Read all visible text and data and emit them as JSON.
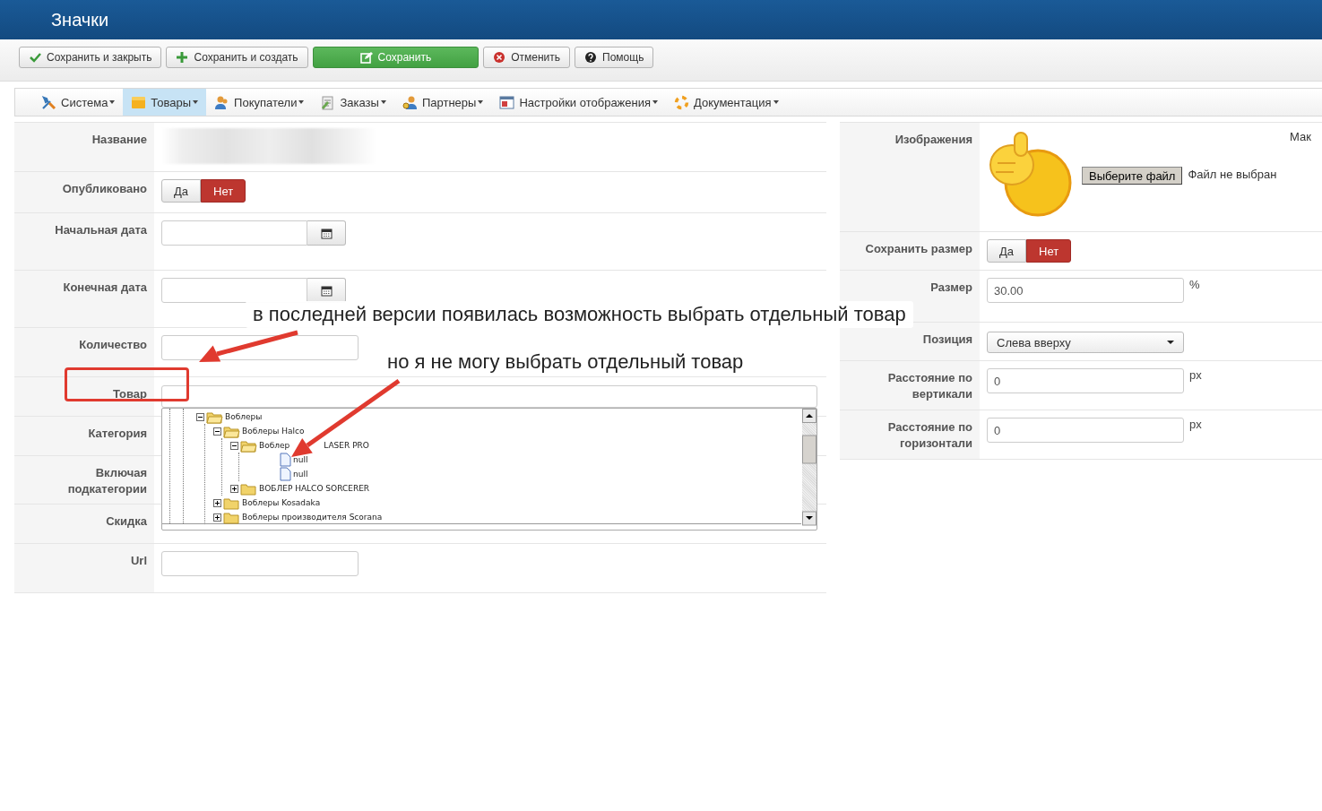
{
  "window": {
    "title": "Значки"
  },
  "toolbar": [
    {
      "label": "Сохранить и закрыть",
      "primary": false
    },
    {
      "label": "Сохранить и создать",
      "primary": false
    },
    {
      "label": "Сохранить",
      "primary": true
    },
    {
      "label": "Отменить",
      "primary": false
    },
    {
      "label": "Помощь",
      "primary": false
    }
  ],
  "menu": [
    {
      "label": "Система",
      "selected": false
    },
    {
      "label": "Товары",
      "selected": true
    },
    {
      "label": "Покупатели",
      "selected": false
    },
    {
      "label": "Заказы",
      "selected": false
    },
    {
      "label": "Партнеры",
      "selected": false
    },
    {
      "label": "Настройки отображения",
      "selected": false
    },
    {
      "label": "Документация",
      "selected": false
    }
  ],
  "left_form": [
    {
      "label": "Название",
      "kind": "redacted"
    },
    {
      "label": "Опубликовано",
      "kind": "toggle",
      "options": [
        {
          "label": "Да",
          "selected": false
        },
        {
          "label": "Нет",
          "selected": true
        }
      ]
    },
    {
      "label": "Начальная дата",
      "kind": "date"
    },
    {
      "label": "Конечная дата",
      "kind": "date"
    },
    {
      "label": "Количество",
      "kind": "input"
    },
    {
      "label": "Товар",
      "kind": "tree_select",
      "tree": [
        {
          "label": "Воблеры",
          "kind": "folder",
          "expanded": true,
          "children": [
            {
              "label": "Воблеры Halco",
              "kind": "folder",
              "expanded": true,
              "children": [
                {
                  "label": "Воблер",
                  "label_end": "LASER PRO",
                  "kind": "folder",
                  "expanded": true,
                  "children": [
                    {
                      "label": "null",
                      "kind": "file"
                    },
                    {
                      "label": "null",
                      "kind": "file"
                    }
                  ]
                },
                {
                  "label": "ВОБЛЕР HALCO SORCERER",
                  "kind": "folder",
                  "expanded": false
                }
              ]
            },
            {
              "label": "Воблеры Kosadaka",
              "kind": "folder",
              "expanded": false
            },
            {
              "label": "Воблеры производителя Scorana",
              "kind": "folder",
              "expanded": false
            }
          ]
        }
      ]
    },
    {
      "label": "Категория",
      "kind": "empty"
    },
    {
      "label": "Включая подкатегории",
      "kind": "empty"
    },
    {
      "label": "Скидка",
      "kind": "empty"
    },
    {
      "label": "Url",
      "kind": "input"
    }
  ],
  "right_form": [
    {
      "label": "Изображения",
      "button": "Выберите файл",
      "status": "Файл не выбран",
      "aside": "Мак"
    },
    {
      "label": "Сохранить размер",
      "kind": "toggle",
      "options": [
        {
          "label": "Да",
          "selected": false
        },
        {
          "label": "Нет",
          "selected": true
        }
      ]
    },
    {
      "label": "Размер",
      "kind": "input",
      "value": "30.00",
      "unit": "%"
    },
    {
      "label": "Позиция",
      "kind": "select",
      "value": "Слева вверху"
    },
    {
      "label": "Расстояние по вертикали",
      "kind": "input",
      "value": "0",
      "unit": "px"
    },
    {
      "label": "Расстояние по горизонтали",
      "kind": "input",
      "value": "0",
      "unit": "px"
    }
  ],
  "annotations": [
    {
      "text": "в последней версии появилась возможность выбрать отдельный товар"
    },
    {
      "text": "но я не могу выбрать отдельный товар"
    }
  ]
}
